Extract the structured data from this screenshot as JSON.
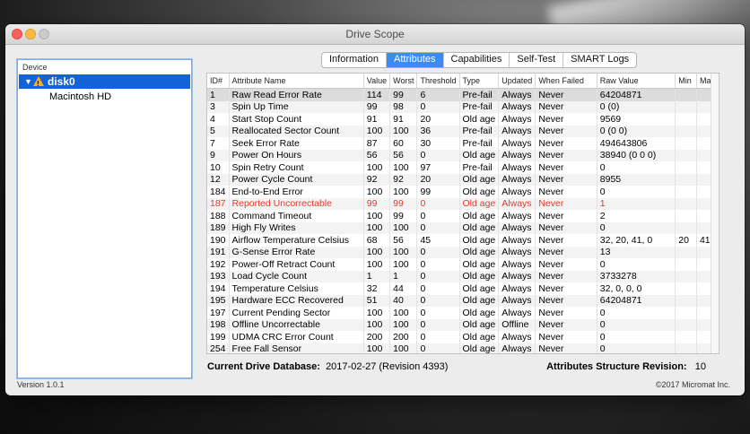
{
  "window": {
    "title": "Drive Scope"
  },
  "sidebar": {
    "header": "Device",
    "device": {
      "label": "disk0"
    },
    "volume": {
      "label": "Macintosh HD"
    }
  },
  "tabs": [
    "Information",
    "Attributes",
    "Capabilities",
    "Self-Test",
    "SMART Logs"
  ],
  "active_tab": "Attributes",
  "table": {
    "columns": [
      "ID#",
      "Attribute Name",
      "Value",
      "Worst",
      "Threshold",
      "Type",
      "Updated",
      "When Failed",
      "Raw Value",
      "Min",
      "Max"
    ],
    "rows": [
      [
        "1",
        "Raw Read Error Rate",
        "114",
        "99",
        "6",
        "Pre-fail",
        "Always",
        "Never",
        "64204871",
        "",
        ""
      ],
      [
        "3",
        "Spin Up Time",
        "99",
        "98",
        "0",
        "Pre-fail",
        "Always",
        "Never",
        "0 (0)",
        "",
        ""
      ],
      [
        "4",
        "Start Stop Count",
        "91",
        "91",
        "20",
        "Old age",
        "Always",
        "Never",
        "9569",
        "",
        ""
      ],
      [
        "5",
        "Reallocated Sector Count",
        "100",
        "100",
        "36",
        "Pre-fail",
        "Always",
        "Never",
        "0 (0 0)",
        "",
        ""
      ],
      [
        "7",
        "Seek Error Rate",
        "87",
        "60",
        "30",
        "Pre-fail",
        "Always",
        "Never",
        "494643806",
        "",
        ""
      ],
      [
        "9",
        "Power On Hours",
        "56",
        "56",
        "0",
        "Old age",
        "Always",
        "Never",
        "38940 (0 0 0)",
        "",
        ""
      ],
      [
        "10",
        "Spin Retry Count",
        "100",
        "100",
        "97",
        "Pre-fail",
        "Always",
        "Never",
        "0",
        "",
        ""
      ],
      [
        "12",
        "Power Cycle Count",
        "92",
        "92",
        "20",
        "Old age",
        "Always",
        "Never",
        "8955",
        "",
        ""
      ],
      [
        "184",
        "End-to-End Error",
        "100",
        "100",
        "99",
        "Old age",
        "Always",
        "Never",
        "0",
        "",
        ""
      ],
      [
        "187",
        "Reported Uncorrectable",
        "99",
        "99",
        "0",
        "Old age",
        "Always",
        "Never",
        "1",
        "",
        ""
      ],
      [
        "188",
        "Command Timeout",
        "100",
        "99",
        "0",
        "Old age",
        "Always",
        "Never",
        "2",
        "",
        ""
      ],
      [
        "189",
        "High Fly Writes",
        "100",
        "100",
        "0",
        "Old age",
        "Always",
        "Never",
        "0",
        "",
        ""
      ],
      [
        "190",
        "Airflow Temperature Celsius",
        "68",
        "56",
        "45",
        "Old age",
        "Always",
        "Never",
        "32, 20, 41, 0",
        "20",
        "41"
      ],
      [
        "191",
        "G-Sense Error Rate",
        "100",
        "100",
        "0",
        "Old age",
        "Always",
        "Never",
        "13",
        "",
        ""
      ],
      [
        "192",
        "Power-Off Retract Count",
        "100",
        "100",
        "0",
        "Old age",
        "Always",
        "Never",
        "0",
        "",
        ""
      ],
      [
        "193",
        "Load Cycle Count",
        "1",
        "1",
        "0",
        "Old age",
        "Always",
        "Never",
        "3733278",
        "",
        ""
      ],
      [
        "194",
        "Temperature Celsius",
        "32",
        "44",
        "0",
        "Old age",
        "Always",
        "Never",
        "32, 0, 0, 0",
        "",
        ""
      ],
      [
        "195",
        "Hardware ECC Recovered",
        "51",
        "40",
        "0",
        "Old age",
        "Always",
        "Never",
        "64204871",
        "",
        ""
      ],
      [
        "197",
        "Current Pending Sector",
        "100",
        "100",
        "0",
        "Old age",
        "Always",
        "Never",
        "0",
        "",
        ""
      ],
      [
        "198",
        "Offline Uncorrectable",
        "100",
        "100",
        "0",
        "Old age",
        "Offline",
        "Never",
        "0",
        "",
        ""
      ],
      [
        "199",
        "UDMA CRC Error Count",
        "200",
        "200",
        "0",
        "Old age",
        "Always",
        "Never",
        "0",
        "",
        ""
      ],
      [
        "254",
        "Free Fall Sensor",
        "100",
        "100",
        "0",
        "Old age",
        "Always",
        "Never",
        "0",
        "",
        ""
      ]
    ],
    "failed_row_id": "187",
    "failed_color": "#e8392b"
  },
  "footer": {
    "db_label": "Current Drive Database:",
    "db_value": "2017-02-27 (Revision 4393)",
    "rev_label": "Attributes Structure Revision:",
    "rev_value": "10"
  },
  "status": {
    "version": "Version 1.0.1",
    "copyright": "©2017 Micromat Inc."
  },
  "colors": {
    "selection": "#1163d9",
    "tab_active": "#3b8bf5",
    "warning": "#f5b021"
  }
}
